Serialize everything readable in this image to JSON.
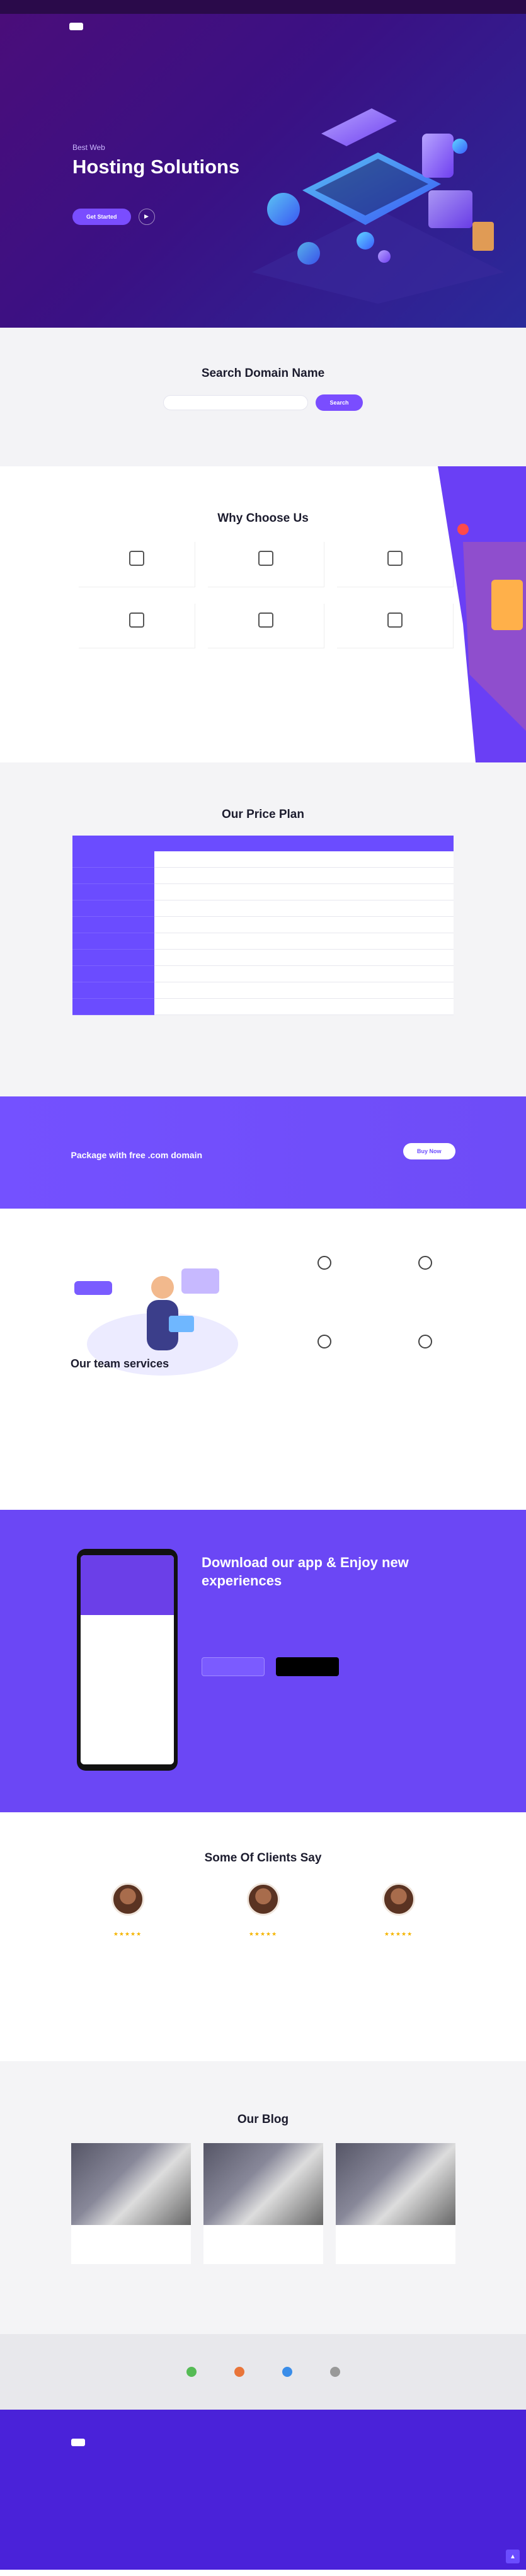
{
  "hero": {
    "eyebrow": "Best Web",
    "title": "Hosting Solutions",
    "cta": "Get Started"
  },
  "search": {
    "title": "Search Domain Name",
    "placeholder": "",
    "button": "Search"
  },
  "why": {
    "title": "Why Choose Us",
    "items": [
      {
        "title": ""
      },
      {
        "title": ""
      },
      {
        "title": ""
      },
      {
        "title": ""
      },
      {
        "title": ""
      },
      {
        "title": ""
      }
    ]
  },
  "price": {
    "title": "Our Price Plan"
  },
  "banner": {
    "title": "Package with free .com domain",
    "button": "Buy Now"
  },
  "team": {
    "title": "Our team services"
  },
  "app": {
    "title": "Download our app & Enjoy new experiences"
  },
  "clients": {
    "title": "Some Of Clients Say"
  },
  "blog": {
    "title": "Our Blog"
  },
  "colors": {
    "accent": "#6b4cff",
    "hero": "#3a1184",
    "footer": "#4a22d9"
  }
}
